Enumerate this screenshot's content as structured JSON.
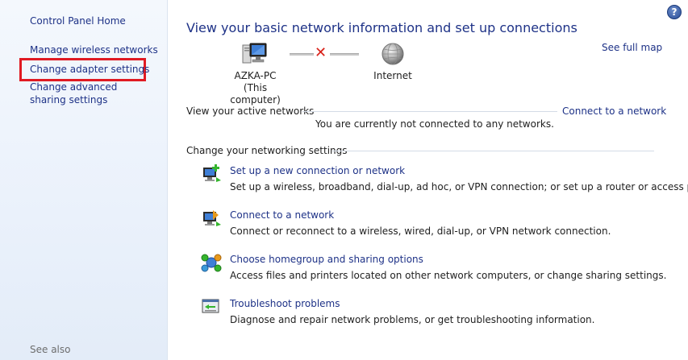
{
  "sidebar": {
    "home": "Control Panel Home",
    "links": [
      "Manage wireless networks",
      "Change adapter settings",
      "Change advanced sharing settings"
    ],
    "see_also": "See also"
  },
  "main": {
    "title": "View your basic network information and set up connections",
    "help": "?",
    "see_full_map": "See full map",
    "map": {
      "computer_name": "AZKA-PC",
      "computer_sub": "(This computer)",
      "internet": "Internet"
    },
    "active_networks": {
      "header": "View your active networks",
      "connect_link": "Connect to a network",
      "status": "You are currently not connected to any networks."
    },
    "settings": {
      "header": "Change your networking settings",
      "tasks": [
        {
          "title": "Set up a new connection or network",
          "desc": "Set up a wireless, broadband, dial-up, ad hoc, or VPN connection; or set up a router or access point.",
          "icon": "new-connection-icon"
        },
        {
          "title": "Connect to a network",
          "desc": "Connect or reconnect to a wireless, wired, dial-up, or VPN network connection.",
          "icon": "connect-network-icon"
        },
        {
          "title": "Choose homegroup and sharing options",
          "desc": "Access files and printers located on other network computers, or change sharing settings.",
          "icon": "homegroup-icon"
        },
        {
          "title": "Troubleshoot problems",
          "desc": "Diagnose and repair network problems, or get troubleshooting information.",
          "icon": "troubleshoot-icon"
        }
      ]
    }
  },
  "colors": {
    "link": "#1e3287",
    "highlight_border": "#e01a22",
    "sidebar_bg": "#eaf1fb",
    "error_x": "#d82018"
  }
}
